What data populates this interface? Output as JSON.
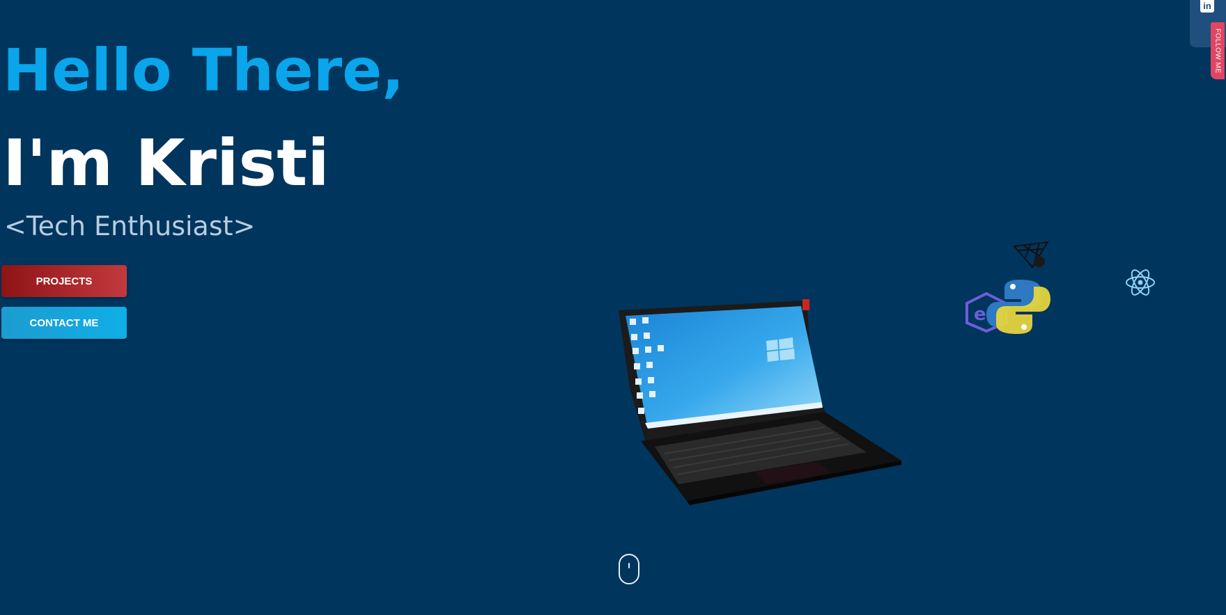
{
  "hero": {
    "greeting": "Hello There,",
    "name": "I'm Kristi",
    "role": "<Tech Enthusiast>"
  },
  "buttons": {
    "projects": "PROJECTS",
    "contact": "CONTACT ME"
  },
  "social": {
    "follow_label": "FOLLOW ME",
    "linkedin_glyph": "in",
    "linkedin_icon": "linkedin-icon"
  },
  "icons": {
    "laptop": "laptop-3d-icon",
    "threejs": "threejs-icon",
    "ethereum": "ethereum-icon",
    "python": "python-icon",
    "react": "react-icon",
    "scroll": "scroll-mouse-icon"
  },
  "colors": {
    "background": "#00355d",
    "greeting": "#0aa5ea",
    "name": "#ffffff",
    "role": "#b9cde2",
    "projects_button": "#a32428",
    "contact_button": "#17a6dd",
    "follow_tab": "#e04561"
  }
}
